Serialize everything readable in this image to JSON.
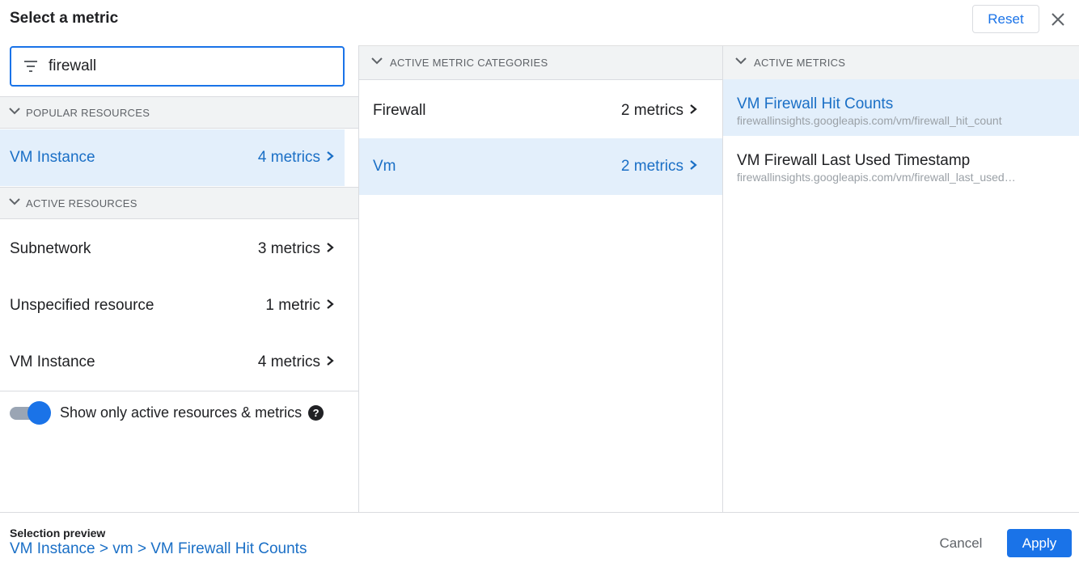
{
  "dialog": {
    "title": "Select a metric",
    "reset_label": "Reset"
  },
  "search": {
    "value": "firewall"
  },
  "resources": {
    "popular_header": "POPULAR RESOURCES",
    "popular": [
      {
        "name": "VM Instance",
        "count": "4 metrics",
        "selected": true
      }
    ],
    "active_header": "ACTIVE RESOURCES",
    "active": [
      {
        "name": "Subnetwork",
        "count": "3 metrics"
      },
      {
        "name": "Unspecified resource",
        "count": "1 metric"
      },
      {
        "name": "VM Instance",
        "count": "4 metrics"
      }
    ],
    "toggle_label": "Show only active resources & metrics",
    "toggle_on": true
  },
  "categories": {
    "header": "ACTIVE METRIC CATEGORIES",
    "items": [
      {
        "name": "Firewall",
        "count": "2 metrics"
      },
      {
        "name": "Vm",
        "count": "2 metrics",
        "selected": true
      }
    ]
  },
  "metrics": {
    "header": "ACTIVE METRICS",
    "items": [
      {
        "name": "VM Firewall Hit Counts",
        "path": "firewallinsights.googleapis.com/vm/firewall_hit_count",
        "selected": true
      },
      {
        "name": "VM Firewall Last Used Timestamp",
        "path": "firewallinsights.googleapis.com/vm/firewall_last_used_timestamp"
      }
    ]
  },
  "footer": {
    "preview_label": "Selection preview",
    "preview_path": "VM Instance > vm > VM Firewall Hit Counts",
    "cancel_label": "Cancel",
    "apply_label": "Apply"
  },
  "colors": {
    "accent": "#1a73e8",
    "selected_bg": "#e3effb",
    "selected_text": "#1a6fc6"
  }
}
